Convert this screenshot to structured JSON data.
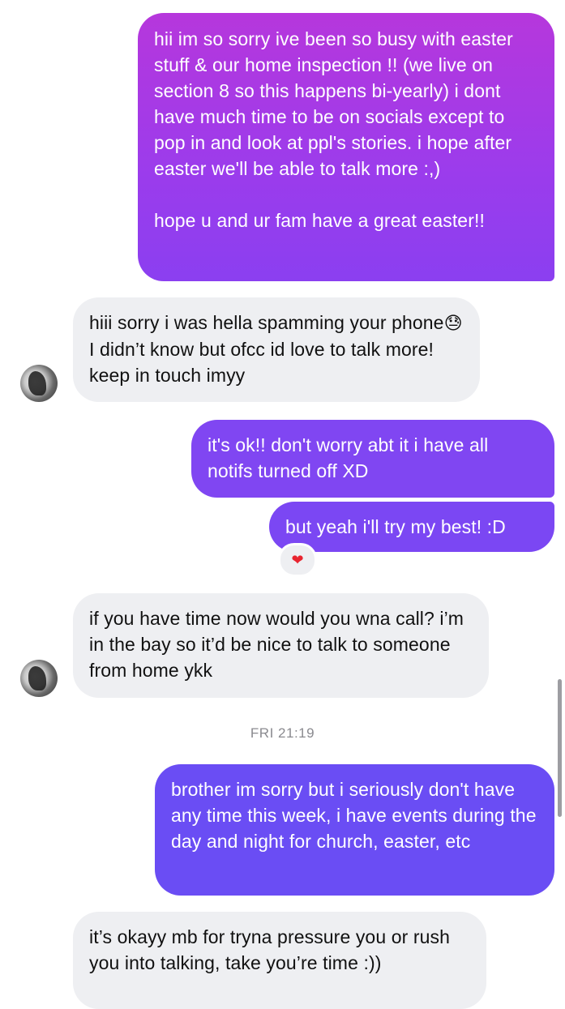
{
  "messages": [
    {
      "id": "b1",
      "direction": "outgoing",
      "text": "hii im so sorry ive been so busy with easter stuff & our home inspection !! (we live on section 8 so this happens bi-yearly) i dont have much time to be on socials except to pop in and look at ppl's stories. i hope after easter we'll be able to talk more :,)\n\nhope u and ur fam have a great easter!!"
    },
    {
      "id": "b2",
      "direction": "incoming",
      "text_before_emoji": "hiii sorry i was hella spamming your phone",
      "emoji": "😓",
      "text_after_emoji": " I didn’t know but ofcc id love to talk more! keep in touch imyy"
    },
    {
      "id": "b3",
      "direction": "outgoing",
      "text": "it's ok!! don't worry abt it i have all notifs turned off XD"
    },
    {
      "id": "b4",
      "direction": "outgoing",
      "text": "but yeah i'll try my best! :D",
      "reaction": "❤"
    },
    {
      "id": "b5",
      "direction": "incoming",
      "text": "if you have time now would you wna call? i’m in the bay so it’d be nice to talk to someone from home ykk"
    },
    {
      "id": "b6",
      "direction": "outgoing",
      "text": "brother im sorry but i seriously don't have any time this week, i have events during the day and night for church, easter, etc"
    },
    {
      "id": "b7",
      "direction": "incoming",
      "text": "it’s okayy mb for tryna pressure you or rush you into talking, take you’re time :))"
    }
  ],
  "timestamp": "FRI 21:19",
  "colors": {
    "incoming_bubble": "#eeeff2",
    "outgoing_top": "#b637dc",
    "outgoing_bottom": "#6a4df4",
    "reaction_heart": "#e8242f",
    "timestamp_text": "#8a8a8f"
  },
  "icons": {
    "avatar": "contact-avatar",
    "reaction": "heart-reaction-icon"
  }
}
